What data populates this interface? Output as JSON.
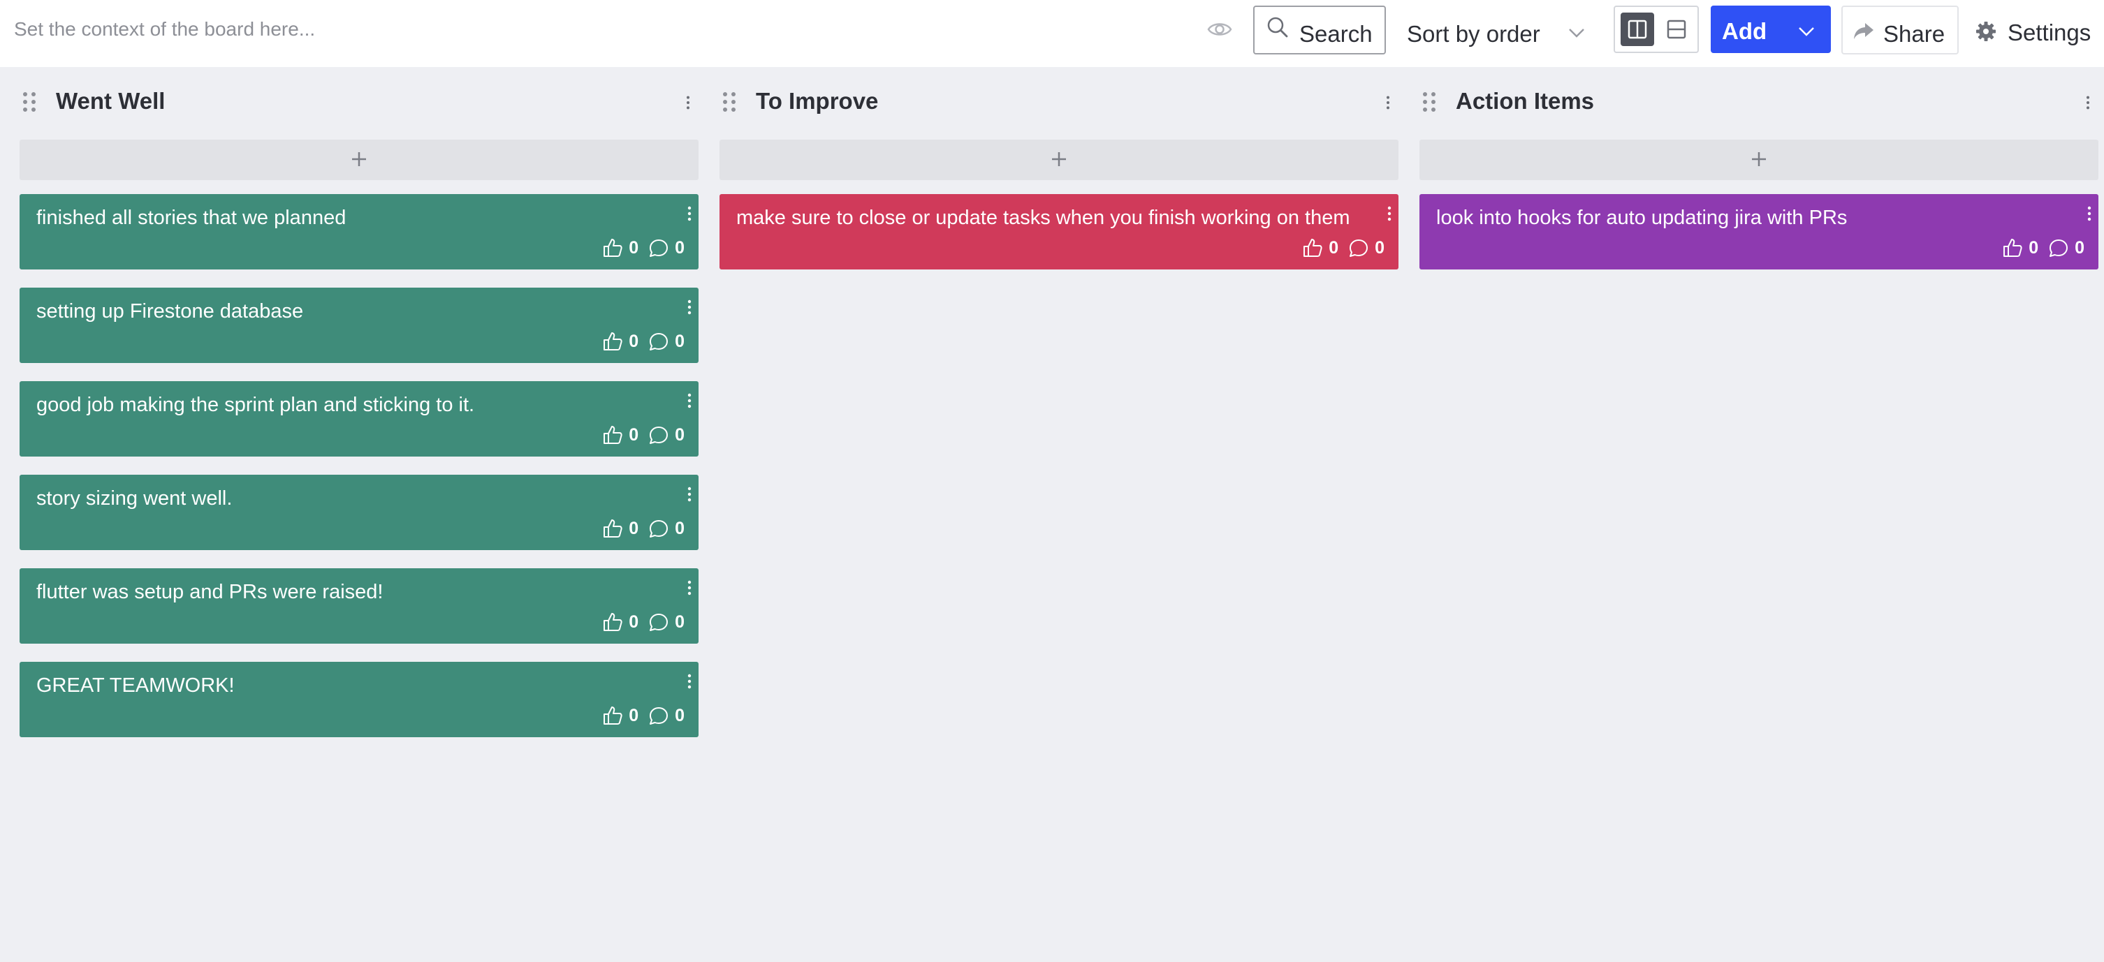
{
  "toolbar": {
    "context_placeholder": "Set the context of the board here...",
    "search_label": "Search",
    "sort_label": "Sort by order",
    "add_label": "Add",
    "share_label": "Share",
    "settings_label": "Settings",
    "accent_color": "#2f51f5",
    "icons": [
      "eye-icon",
      "search-icon",
      "chevron-down-icon",
      "columns-view-icon",
      "rows-view-icon",
      "share-arrow-icon",
      "gear-icon"
    ]
  },
  "columns": [
    {
      "title": "Went Well",
      "color": "#3f8c7a",
      "cards": [
        {
          "text": "finished all stories that we planned",
          "likes": "0",
          "comments": "0"
        },
        {
          "text": "setting up Firestone database",
          "likes": "0",
          "comments": "0"
        },
        {
          "text": "good job making the sprint plan and sticking to it.",
          "likes": "0",
          "comments": "0"
        },
        {
          "text": "story sizing went well.",
          "likes": "0",
          "comments": "0"
        },
        {
          "text": "flutter was setup and PRs were raised!",
          "likes": "0",
          "comments": "0"
        },
        {
          "text": "GREAT TEAMWORK!",
          "likes": "0",
          "comments": "0"
        }
      ]
    },
    {
      "title": "To Improve",
      "color": "#d03a5a",
      "cards": [
        {
          "text": "make sure to close or update tasks when you finish working on them",
          "likes": "0",
          "comments": "0"
        }
      ]
    },
    {
      "title": "Action Items",
      "color": "#8e3ab0",
      "cards": [
        {
          "text": "look into hooks for auto updating jira with PRs",
          "likes": "0",
          "comments": "0"
        }
      ]
    }
  ]
}
